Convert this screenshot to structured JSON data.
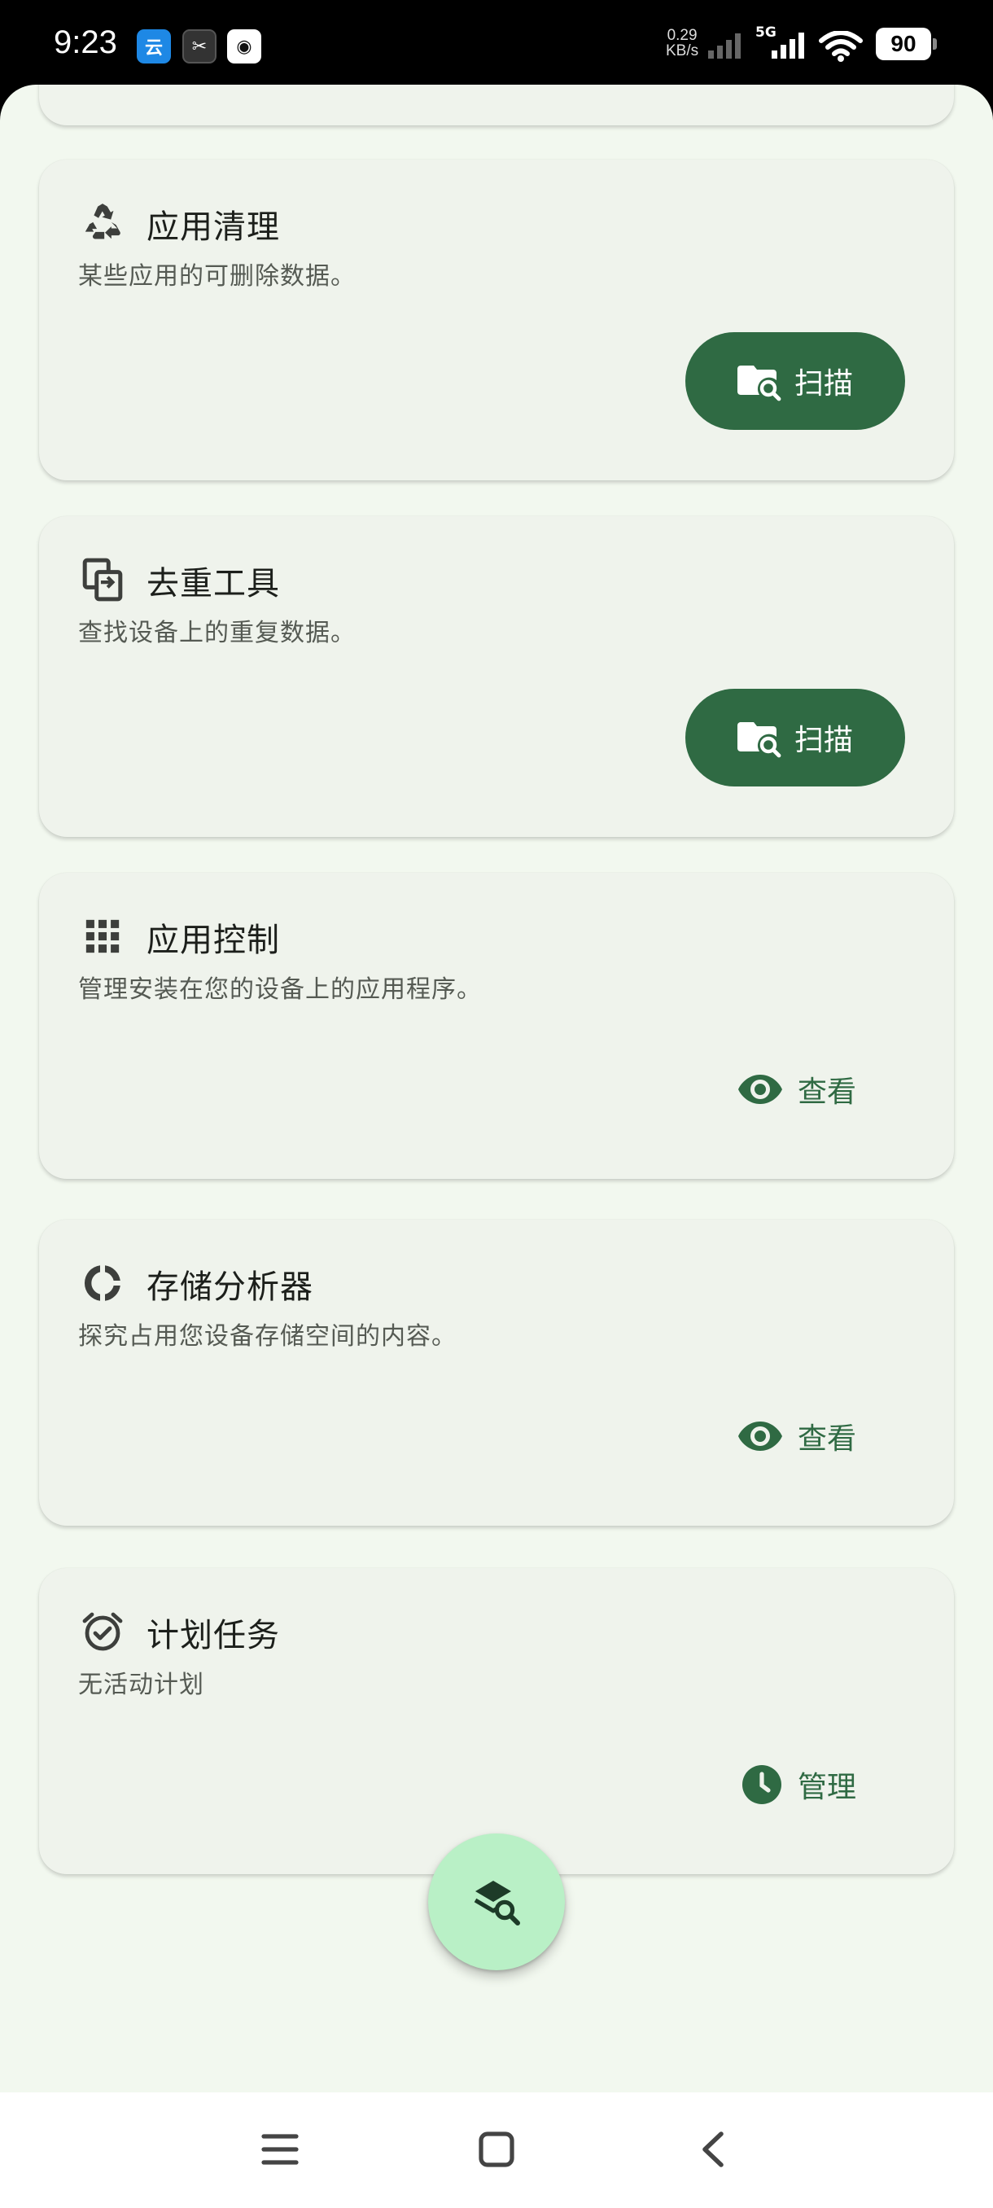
{
  "status_bar": {
    "time": "9:23",
    "app_icons": [
      "云",
      "✂",
      "◉"
    ],
    "net_speed_value": "0.29",
    "net_speed_unit": "KB/s",
    "network": "5G",
    "battery": "90"
  },
  "cards": [
    {
      "title": "应用清理",
      "description": "某些应用的可删除数据。",
      "icon": "recycle-icon",
      "action_label": "扫描",
      "action_icon": "folder-search-icon"
    },
    {
      "title": "去重工具",
      "description": "查找设备上的重复数据。",
      "icon": "duplicate-icon",
      "action_label": "扫描",
      "action_icon": "folder-search-icon"
    },
    {
      "title": "应用控制",
      "description": "管理安装在您的设备上的应用程序。",
      "icon": "apps-grid-icon",
      "action_label": "查看",
      "action_icon": "eye-icon"
    },
    {
      "title": "存储分析器",
      "description": "探究占用您设备存储空间的内容。",
      "icon": "donut-chart-icon",
      "action_label": "查看",
      "action_icon": "eye-icon"
    },
    {
      "title": "计划任务",
      "description": "无活动计划",
      "icon": "alarm-check-icon",
      "action_label": "管理",
      "action_icon": "clock-icon"
    }
  ],
  "fab": {
    "icon": "layers-search-icon"
  },
  "navbar": {
    "icons": [
      "menu-icon",
      "home-square-icon",
      "back-chevron-icon"
    ]
  },
  "colors": {
    "primary": "#2f6a43",
    "background": "#f2f8ef",
    "card": "#eff3ec",
    "fab": "#b9f0c6"
  }
}
